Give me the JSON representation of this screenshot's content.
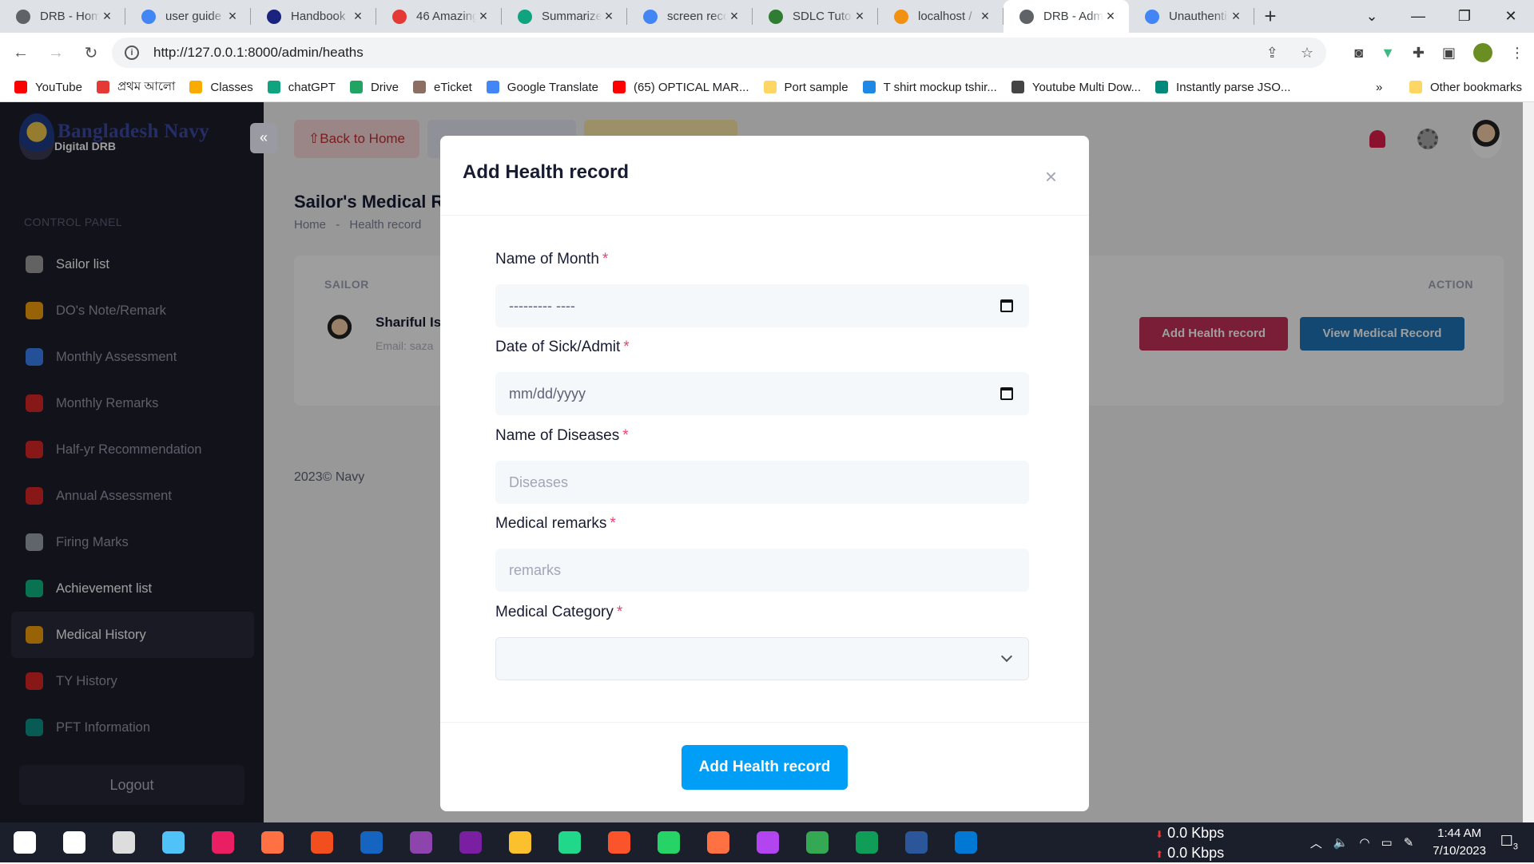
{
  "browser": {
    "tabs": [
      {
        "title": "DRB - Home",
        "color": "#5f6368"
      },
      {
        "title": "user guide",
        "color": "#4285f4"
      },
      {
        "title": "Handbook",
        "color": "#1a237e"
      },
      {
        "title": "46 Amazing",
        "color": "#e53935"
      },
      {
        "title": "Summarize",
        "color": "#10a37f"
      },
      {
        "title": "screen reco",
        "color": "#4285f4"
      },
      {
        "title": "SDLC Tutori",
        "color": "#2e7d32"
      },
      {
        "title": "localhost /",
        "color": "#f29111"
      },
      {
        "title": "DRB - Adm",
        "color": "#5f6368",
        "active": true
      },
      {
        "title": "Unauthenti",
        "color": "#4285f4"
      }
    ],
    "url": "http://127.0.0.1:8000/admin/heaths",
    "bookmarks": [
      {
        "label": "YouTube",
        "color": "#ff0000"
      },
      {
        "label": "প্রথম আলো",
        "color": "#e53935"
      },
      {
        "label": "Classes",
        "color": "#f9ab00"
      },
      {
        "label": "chatGPT",
        "color": "#10a37f"
      },
      {
        "label": "Drive",
        "color": "#1fa463"
      },
      {
        "label": "eTicket",
        "color": "#8d6e63"
      },
      {
        "label": "Google Translate",
        "color": "#4285f4"
      },
      {
        "label": "(65) OPTICAL MAR...",
        "color": "#ff0000"
      },
      {
        "label": "Port sample",
        "color": "#fdd663"
      },
      {
        "label": "T shirt mockup tshir...",
        "color": "#1e88e5"
      },
      {
        "label": "Youtube Multi Dow...",
        "color": "#444"
      },
      {
        "label": "Instantly parse JSO...",
        "color": "#00897b"
      }
    ],
    "overflow": "»",
    "other_bookmarks": "Other bookmarks"
  },
  "sidebar": {
    "brand": "Bangladesh Navy",
    "brand_sub": "Digital DRB",
    "section": "CONTROL PANEL",
    "items": [
      {
        "label": "Sailor list",
        "color": "#9e9e9e"
      },
      {
        "label": "DO's Note/Remark",
        "color": "#f59e0b"
      },
      {
        "label": "Monthly Assessment",
        "color": "#3b82f6"
      },
      {
        "label": "Monthly Remarks",
        "color": "#dc2626"
      },
      {
        "label": "Half-yr Recommendation",
        "color": "#dc2626"
      },
      {
        "label": "Annual Assessment",
        "color": "#dc2626"
      },
      {
        "label": "Firing Marks",
        "color": "#9ca3af"
      },
      {
        "label": "Achievement list",
        "color": "#10b981"
      },
      {
        "label": "Medical History",
        "color": "#f59e0b"
      },
      {
        "label": "TY History",
        "color": "#dc2626"
      },
      {
        "label": "PFT Information",
        "color": "#0d9488"
      }
    ],
    "logout": "Logout"
  },
  "header": {
    "back_home": "⇧Back to Home",
    "btn2": "",
    "btn3": ""
  },
  "page": {
    "title": "Sailor's Medical R",
    "breadcrumb_home": "Home",
    "breadcrumb_sep": "-",
    "breadcrumb_current": "Health record",
    "table": {
      "col_sailor": "SAILOR",
      "col_action": "ACTION",
      "sailor_name": "Shariful Is",
      "sailor_email": "Email: saza"
    },
    "add_btn": "Add Health record",
    "view_btn": "View Medical Record",
    "footer": "2023© Navy"
  },
  "modal": {
    "title": "Add Health record",
    "close": "×",
    "fields": {
      "month_label": "Name of Month",
      "month_value": "--------- ----",
      "date_label": "Date of Sick/Admit",
      "date_value": "mm/dd/yyyy",
      "disease_label": "Name of Diseases",
      "disease_placeholder": "Diseases",
      "remarks_label": "Medical remarks",
      "remarks_placeholder": "remarks",
      "category_label": "Medical Category",
      "category_value": ""
    },
    "required_mark": "*",
    "submit": "Add Health record"
  },
  "taskbar": {
    "net_up": "0.0 Kbps",
    "net_down": "0.0 Kbps",
    "time": "1:44 AM",
    "date": "7/10/2023",
    "notif_count": "3"
  }
}
